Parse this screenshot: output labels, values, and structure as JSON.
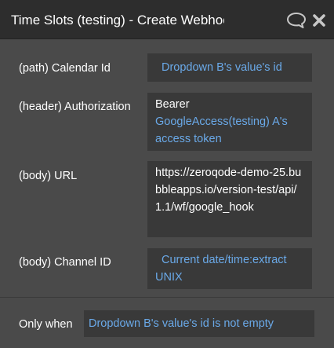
{
  "window": {
    "title": "Time Slots (testing) - Create Webhook",
    "icons": [
      "comment-icon",
      "close-icon"
    ]
  },
  "fields": {
    "calendar_id": {
      "label": "(path) Calendar Id",
      "value": "Dropdown B's value's id"
    },
    "authorization": {
      "label": "(header) Authorization",
      "prefix": "Bearer",
      "value": "GoogleAccess(testing) A's access token"
    },
    "url": {
      "label": "(body) URL",
      "value": "https://zeroqode-demo-25.bubbleapps.io/version-test/api/1.1/wf/google_hook"
    },
    "channel_id": {
      "label": "(body) Channel ID",
      "value": "Current date/time:extract UNIX"
    }
  },
  "condition": {
    "label": "Only when",
    "value": "Dropdown B's value's id is not empty"
  },
  "colors": {
    "panel_bg": "#4a4a4a",
    "titlebar_bg": "#2d2d2d",
    "field_bg": "#393939",
    "dynamic_text": "#6aa9e8",
    "text": "#ffffff"
  }
}
